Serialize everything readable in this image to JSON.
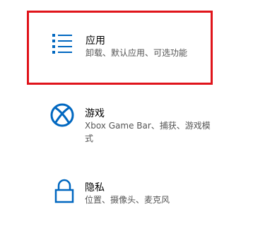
{
  "settings": {
    "tiles": [
      {
        "title": "应用",
        "description": "卸载、默认应用、可选功能",
        "icon": "apps-list-icon",
        "selected": true
      },
      {
        "title": "游戏",
        "description": "Xbox Game Bar、捕获、游戏模式",
        "icon": "xbox-icon",
        "selected": false
      },
      {
        "title": "隐私",
        "description": "位置、摄像头、麦克风",
        "icon": "lock-icon",
        "selected": false
      }
    ]
  },
  "colors": {
    "icon_blue": "#0067c0",
    "highlight_red": "#e0141b"
  }
}
